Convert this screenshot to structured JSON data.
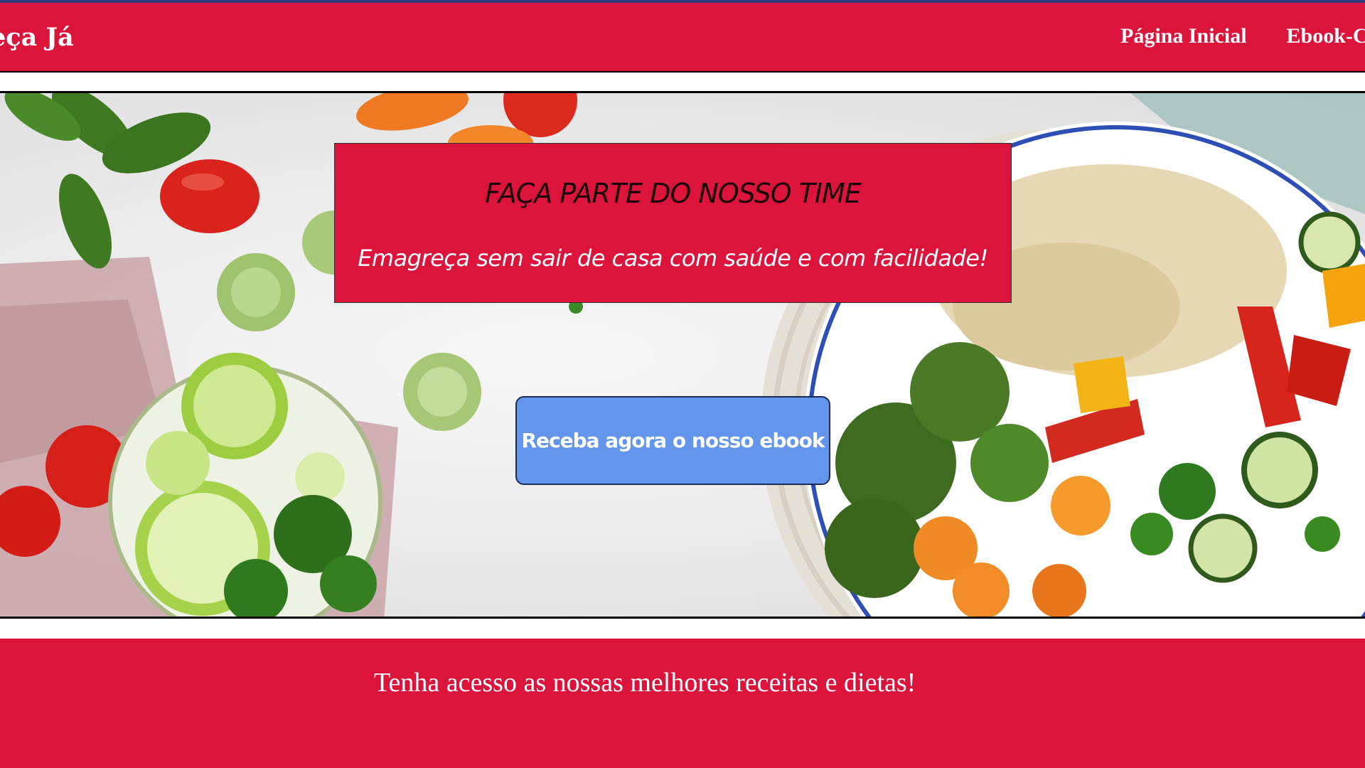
{
  "nav": {
    "brand": "eça Já",
    "links": [
      "Página Inicial",
      "Ebook-C"
    ]
  },
  "hero": {
    "title": "FAÇA PARTE DO NOSSO TIME",
    "subtitle": "Emagreça sem sair de casa com saúde e com facilidade!",
    "cta_label": "Receba agora o nosso ebook"
  },
  "footer": {
    "text": "Tenha acesso as nossas melhores receitas e dietas!"
  },
  "colors": {
    "primary": "#dc143c",
    "button": "#6495ed",
    "text_light": "#ffffff"
  }
}
